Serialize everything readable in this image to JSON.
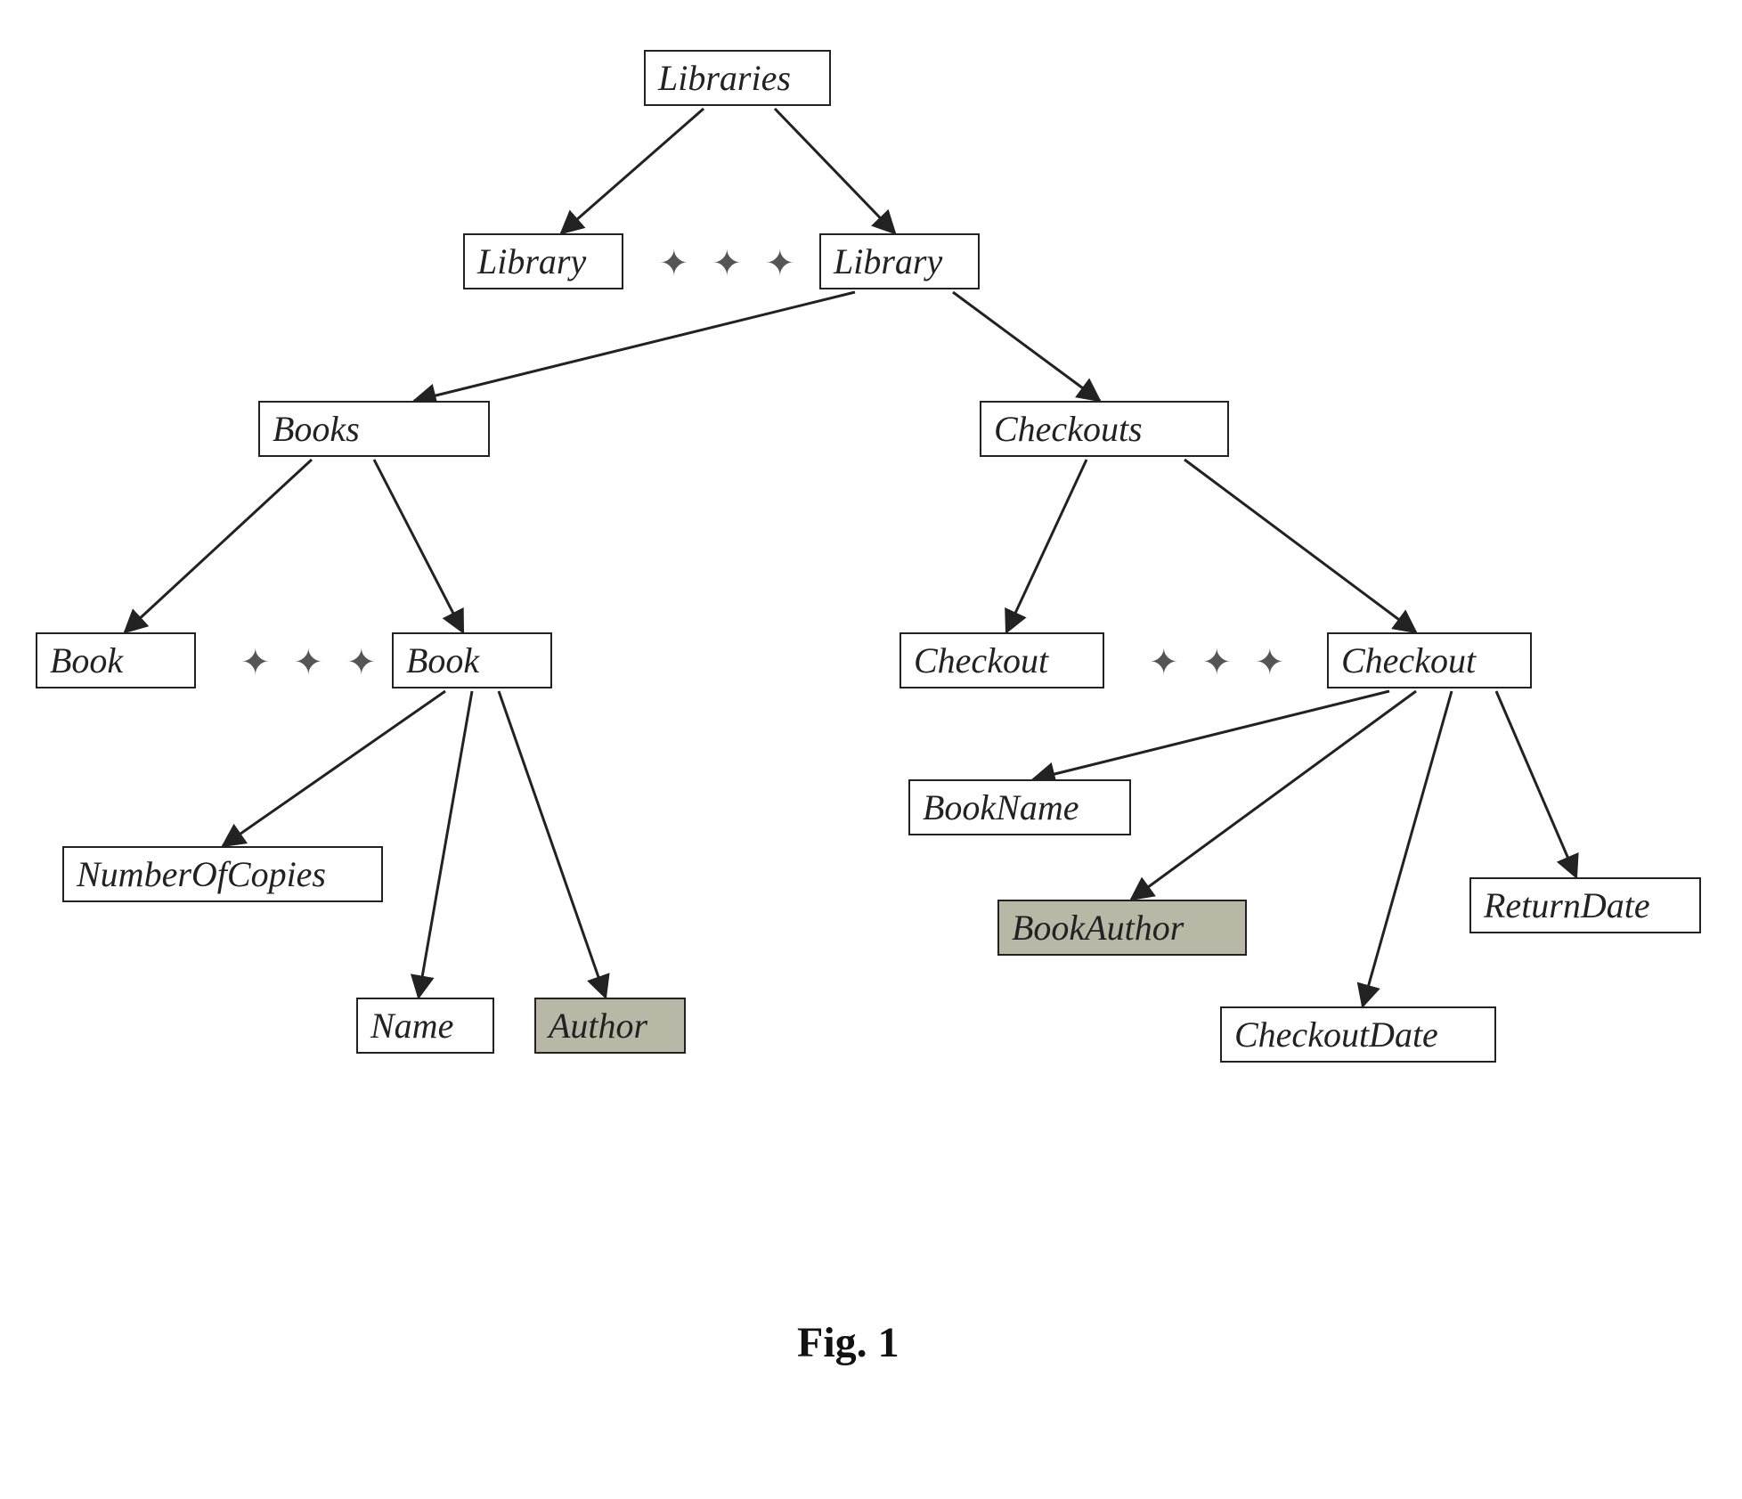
{
  "caption": "Fig. 1",
  "ellipsis": "✦ ✦ ✦",
  "nodes": {
    "libraries": "Libraries",
    "library1": "Library",
    "library2": "Library",
    "books": "Books",
    "checkouts": "Checkouts",
    "book1": "Book",
    "book2": "Book",
    "checkout1": "Checkout",
    "checkout2": "Checkout",
    "numberOfCopies": "NumberOfCopies",
    "name": "Name",
    "author": "Author",
    "bookName": "BookName",
    "bookAuthor": "BookAuthor",
    "returnDate": "ReturnDate",
    "checkoutDate": "CheckoutDate"
  }
}
